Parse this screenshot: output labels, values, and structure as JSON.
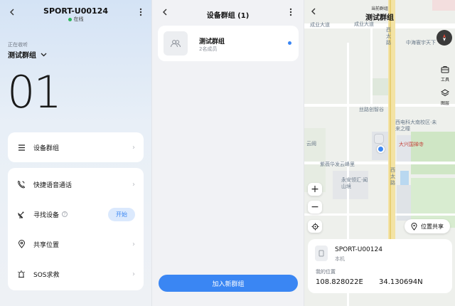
{
  "panel1": {
    "device_name": "SPORT-U00124",
    "status": "在线",
    "receiving_label": "正在收听",
    "group_name": "测试群组",
    "channel_number": "01",
    "menu_device_group": "设备群组",
    "menu_voice_call": "快捷语音通话",
    "menu_find_device": "寻找设备",
    "start_button": "开始",
    "menu_share_location": "共享位置",
    "menu_sos": "SOS求救"
  },
  "panel2": {
    "title": "设备群组 (1)",
    "group_name": "测试群组",
    "member_count": "2名成员",
    "join_button": "加入新群组"
  },
  "panel3": {
    "current_group_label": "当前群组",
    "group_name": "测试群组",
    "tools_label": "工具",
    "layers_label": "图层",
    "location_share_button": "位置共享",
    "zoom_in": "+",
    "zoom_out": "−",
    "device_name": "SPORT-U00124",
    "device_role": "本机",
    "my_location_label": "我的位置",
    "longitude": "108.828022E",
    "latitude": "34.130694N",
    "map_labels": {
      "road_north_left": "成业大道",
      "road_north_mid": "成业大道",
      "road_west_v": "西太路",
      "place_hz": "中海寰宇天下",
      "street_silk": "丝路创智谷",
      "school": "西电科大南校区·未来之瞳",
      "temple": "大兴国禅寺",
      "cloud_view": "云阙",
      "road_west_v2": "西太路",
      "ziwei": "紫薇华发云峰里",
      "yongan": "永安领汇·闻山境"
    }
  },
  "colors": {
    "accent": "#3a86f3",
    "online": "#2ab759"
  }
}
